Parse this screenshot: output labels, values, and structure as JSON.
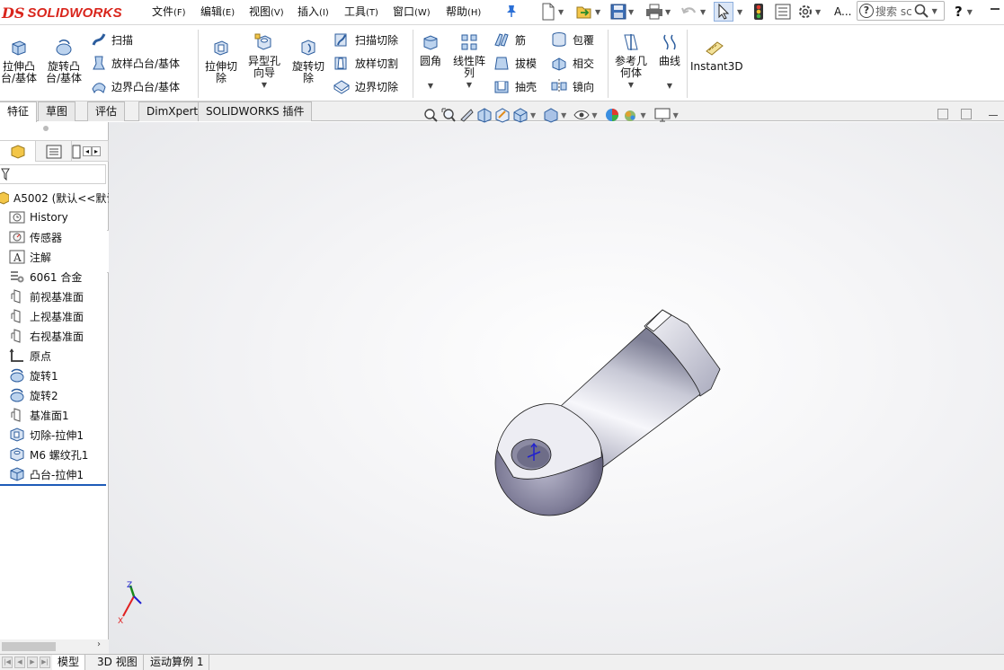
{
  "app": {
    "logo_ds": "DS",
    "logo_brand": "SOLIDWORKS"
  },
  "menu": [
    {
      "label": "文件",
      "accel": "(F)"
    },
    {
      "label": "编辑",
      "accel": "(E)"
    },
    {
      "label": "视图",
      "accel": "(V)"
    },
    {
      "label": "插入",
      "accel": "(I)"
    },
    {
      "label": "工具",
      "accel": "(T)"
    },
    {
      "label": "窗口",
      "accel": "(W)"
    },
    {
      "label": "帮助",
      "accel": "(H)"
    }
  ],
  "quick_toolbar": {
    "icons": [
      "new-file-icon",
      "open-file-icon",
      "save-icon",
      "print-icon",
      "undo-icon",
      "select-arrow-icon",
      "rebuild-traffic-light-icon",
      "file-properties-icon",
      "options-gear-icon"
    ],
    "overflow_label": "A...",
    "search_placeholder": "搜索 sc",
    "help_label": "?"
  },
  "ribbon": {
    "extrude_boss": "拉伸凸\n台/基体",
    "revolve_boss": "旋转凸\n台/基体",
    "sweep": "扫描",
    "loft_boss": "放样凸台/基体",
    "boundary_boss": "边界凸台/基体",
    "extrude_cut": "拉伸切\n除",
    "hole_wizard": "异型孔\n向导",
    "revolve_cut": "旋转切\n除",
    "sweep_cut": "扫描切除",
    "loft_cut": "放样切割",
    "boundary_cut": "边界切除",
    "fillet": "圆角",
    "linear_pattern": "线性阵\n列",
    "rib": "筋",
    "draft": "拔模",
    "shell": "抽壳",
    "wrap": "包覆",
    "intersect": "相交",
    "mirror": "镜向",
    "ref_geometry": "参考几\n何体",
    "curves": "曲线",
    "instant3d": "Instant3D"
  },
  "tabs": [
    "特征",
    "草图",
    "评估",
    "DimXpert",
    "SOLIDWORKS 插件"
  ],
  "active_tab": "特征",
  "tree": {
    "root": "A5002  (默认<<默认",
    "items": [
      {
        "label": "History",
        "icon": "history-icon"
      },
      {
        "label": "传感器",
        "icon": "sensor-icon"
      },
      {
        "label": "注解",
        "icon": "annotation-icon"
      },
      {
        "label": "6061 合金",
        "icon": "material-icon"
      },
      {
        "label": "前视基准面",
        "icon": "plane-icon"
      },
      {
        "label": "上视基准面",
        "icon": "plane-icon"
      },
      {
        "label": "右视基准面",
        "icon": "plane-icon"
      },
      {
        "label": "原点",
        "icon": "origin-icon"
      },
      {
        "label": "旋转1",
        "icon": "revolve-feature-icon"
      },
      {
        "label": "旋转2",
        "icon": "revolve-feature-icon"
      },
      {
        "label": "基准面1",
        "icon": "plane-icon"
      },
      {
        "label": "切除-拉伸1",
        "icon": "extrude-cut-feature-icon"
      },
      {
        "label": "M6 螺纹孔1",
        "icon": "hole-feature-icon"
      },
      {
        "label": "凸台-拉伸1",
        "icon": "extrude-boss-feature-icon"
      }
    ]
  },
  "triad": {
    "z_label": "Z",
    "x_label": "X"
  },
  "bottom_tabs": [
    "模型",
    "3D 视图",
    "运动算例 1"
  ],
  "active_bottom_tab": "模型",
  "colors": {
    "brand_red": "#d9251c",
    "tree_selected": "#1e5bb8",
    "axis_red": "#e02020",
    "axis_green": "#1a8a1a",
    "axis_blue": "#2020d0"
  }
}
